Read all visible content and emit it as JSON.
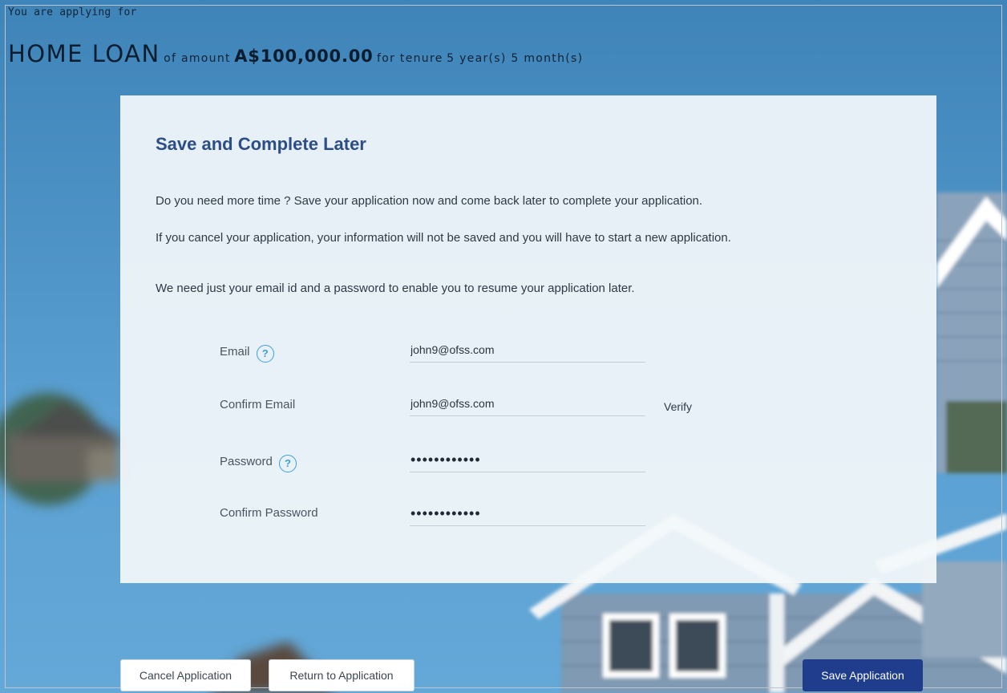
{
  "header": {
    "applying_for": "You are applying for",
    "product": "HOME LOAN",
    "of_amount_text": "of amount",
    "amount": "A$100,000.00",
    "for_tenure_text": "for tenure",
    "tenure": "5 year(s) 5 month(s)"
  },
  "card": {
    "title": "Save and Complete Later",
    "paragraph1": "Do you need more time ? Save your application now and come back later to complete your application.",
    "paragraph2": "If you cancel your application, your information will not be saved and you will have to start a new application.",
    "paragraph3": "We need just your email id and a password to enable you to resume your application later."
  },
  "form": {
    "email_label": "Email",
    "email_value": "john9@ofss.com",
    "confirm_email_label": "Confirm Email",
    "confirm_email_value": "john9@ofss.com",
    "verify_label": "Verify",
    "password_label": "Password",
    "password_value": "••••••••••••",
    "confirm_password_label": "Confirm Password",
    "confirm_password_value": "••••••••••••",
    "help_glyph": "?"
  },
  "buttons": {
    "cancel": "Cancel Application",
    "return": "Return to Application",
    "save": "Save Application"
  },
  "colors": {
    "accent": "#2c4d86",
    "primary_button": "#1f3d8c",
    "help_icon": "#3a9fd8"
  }
}
